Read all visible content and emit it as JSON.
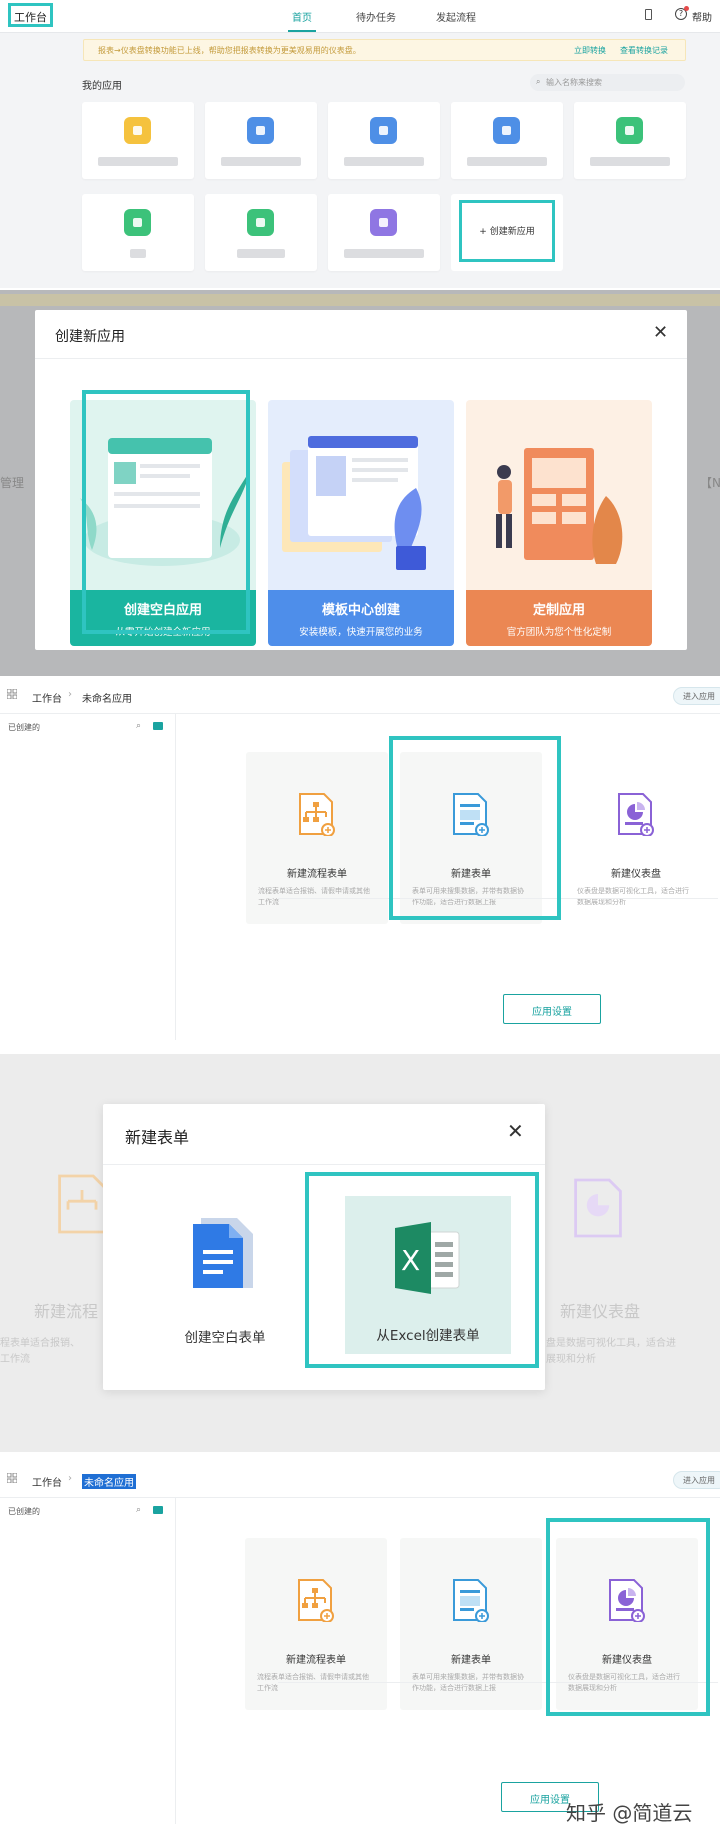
{
  "panel1": {
    "logo": "工作台",
    "nav": [
      "首页",
      "待办任务",
      "发起流程"
    ],
    "help": "帮助",
    "notice": "报表→仪表盘转换功能已上线，帮助您把报表转换为更美观易用的仪表盘。",
    "notice_links": [
      "立即转换",
      "查看转换记录"
    ],
    "my_apps": "我的应用",
    "search_placeholder": "输入名称来搜索",
    "add_app": "+ 创建新应用",
    "colors": {
      "yellow": "#f5c23e",
      "blue": "#4e8fe6",
      "green": "#3cc27a",
      "purple": "#8f76e3"
    }
  },
  "panel2": {
    "backdrop_left": "管理",
    "backdrop_right": "【N",
    "title": "创建新应用",
    "options": [
      {
        "title": "创建空白应用",
        "sub": "从零开始创建全新应用",
        "color": "#1ab5a0"
      },
      {
        "title": "模板中心创建",
        "sub": "安装模板，快速开展您的业务",
        "color": "#4e8eea"
      },
      {
        "title": "定制应用",
        "sub": "官方团队为您个性化定制",
        "color": "#eb8753"
      }
    ]
  },
  "builder": {
    "crumb_root": "工作台",
    "crumb_app": "未命名应用",
    "enter_app": "进入应用",
    "created": "已创建的",
    "cards": [
      {
        "title": "新建流程表单",
        "desc": "流程表单适合报销、请假申请或其他工作流"
      },
      {
        "title": "新建表单",
        "desc": "表单可用来搜集数据，并带有数据协作功能，适合进行数据上报"
      },
      {
        "title": "新建仪表盘",
        "desc": "仪表盘是数据可视化工具，适合进行数据展现和分析"
      }
    ],
    "settings": "应用设置"
  },
  "panel4": {
    "title": "新建表单",
    "opt1": "创建空白表单",
    "opt2": "从Excel创建表单",
    "ghost_left": "新建流程",
    "ghost_left_sub": "程表单适合报销、\n工作流",
    "ghost_right": "新建仪表盘",
    "ghost_right_sub": "盘是数据可视化工具，适合进\n展现和分析"
  },
  "watermark": "知乎 @简道云"
}
